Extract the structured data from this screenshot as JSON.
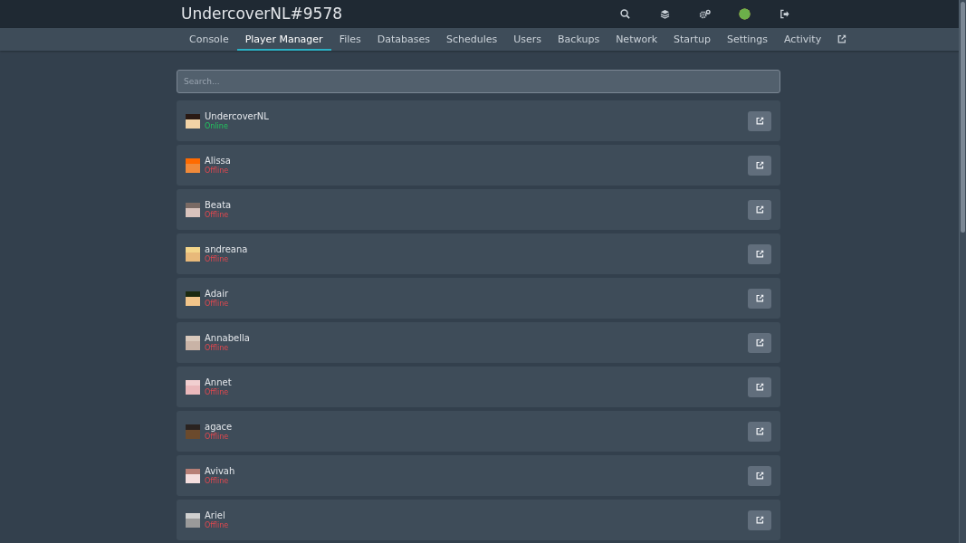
{
  "header": {
    "title": "UndercoverNL#9578"
  },
  "tabs": [
    {
      "label": "Console",
      "selected": false
    },
    {
      "label": "Player Manager",
      "selected": true
    },
    {
      "label": "Files",
      "selected": false
    },
    {
      "label": "Databases",
      "selected": false
    },
    {
      "label": "Schedules",
      "selected": false
    },
    {
      "label": "Users",
      "selected": false
    },
    {
      "label": "Backups",
      "selected": false
    },
    {
      "label": "Network",
      "selected": false
    },
    {
      "label": "Startup",
      "selected": false
    },
    {
      "label": "Settings",
      "selected": false
    },
    {
      "label": "Activity",
      "selected": false
    }
  ],
  "search": {
    "placeholder": "Search..."
  },
  "players": [
    {
      "name": "UndercoverNL",
      "status": "Online",
      "online": true
    },
    {
      "name": "Alissa",
      "status": "Offline",
      "online": false
    },
    {
      "name": "Beata",
      "status": "Offline",
      "online": false
    },
    {
      "name": "andreana",
      "status": "Offline",
      "online": false
    },
    {
      "name": "Adair",
      "status": "Offline",
      "online": false
    },
    {
      "name": "Annabella",
      "status": "Offline",
      "online": false
    },
    {
      "name": "Annet",
      "status": "Offline",
      "online": false
    },
    {
      "name": "agace",
      "status": "Offline",
      "online": false
    },
    {
      "name": "Avivah",
      "status": "Offline",
      "online": false
    },
    {
      "name": "Ariel",
      "status": "Offline",
      "online": false
    }
  ]
}
